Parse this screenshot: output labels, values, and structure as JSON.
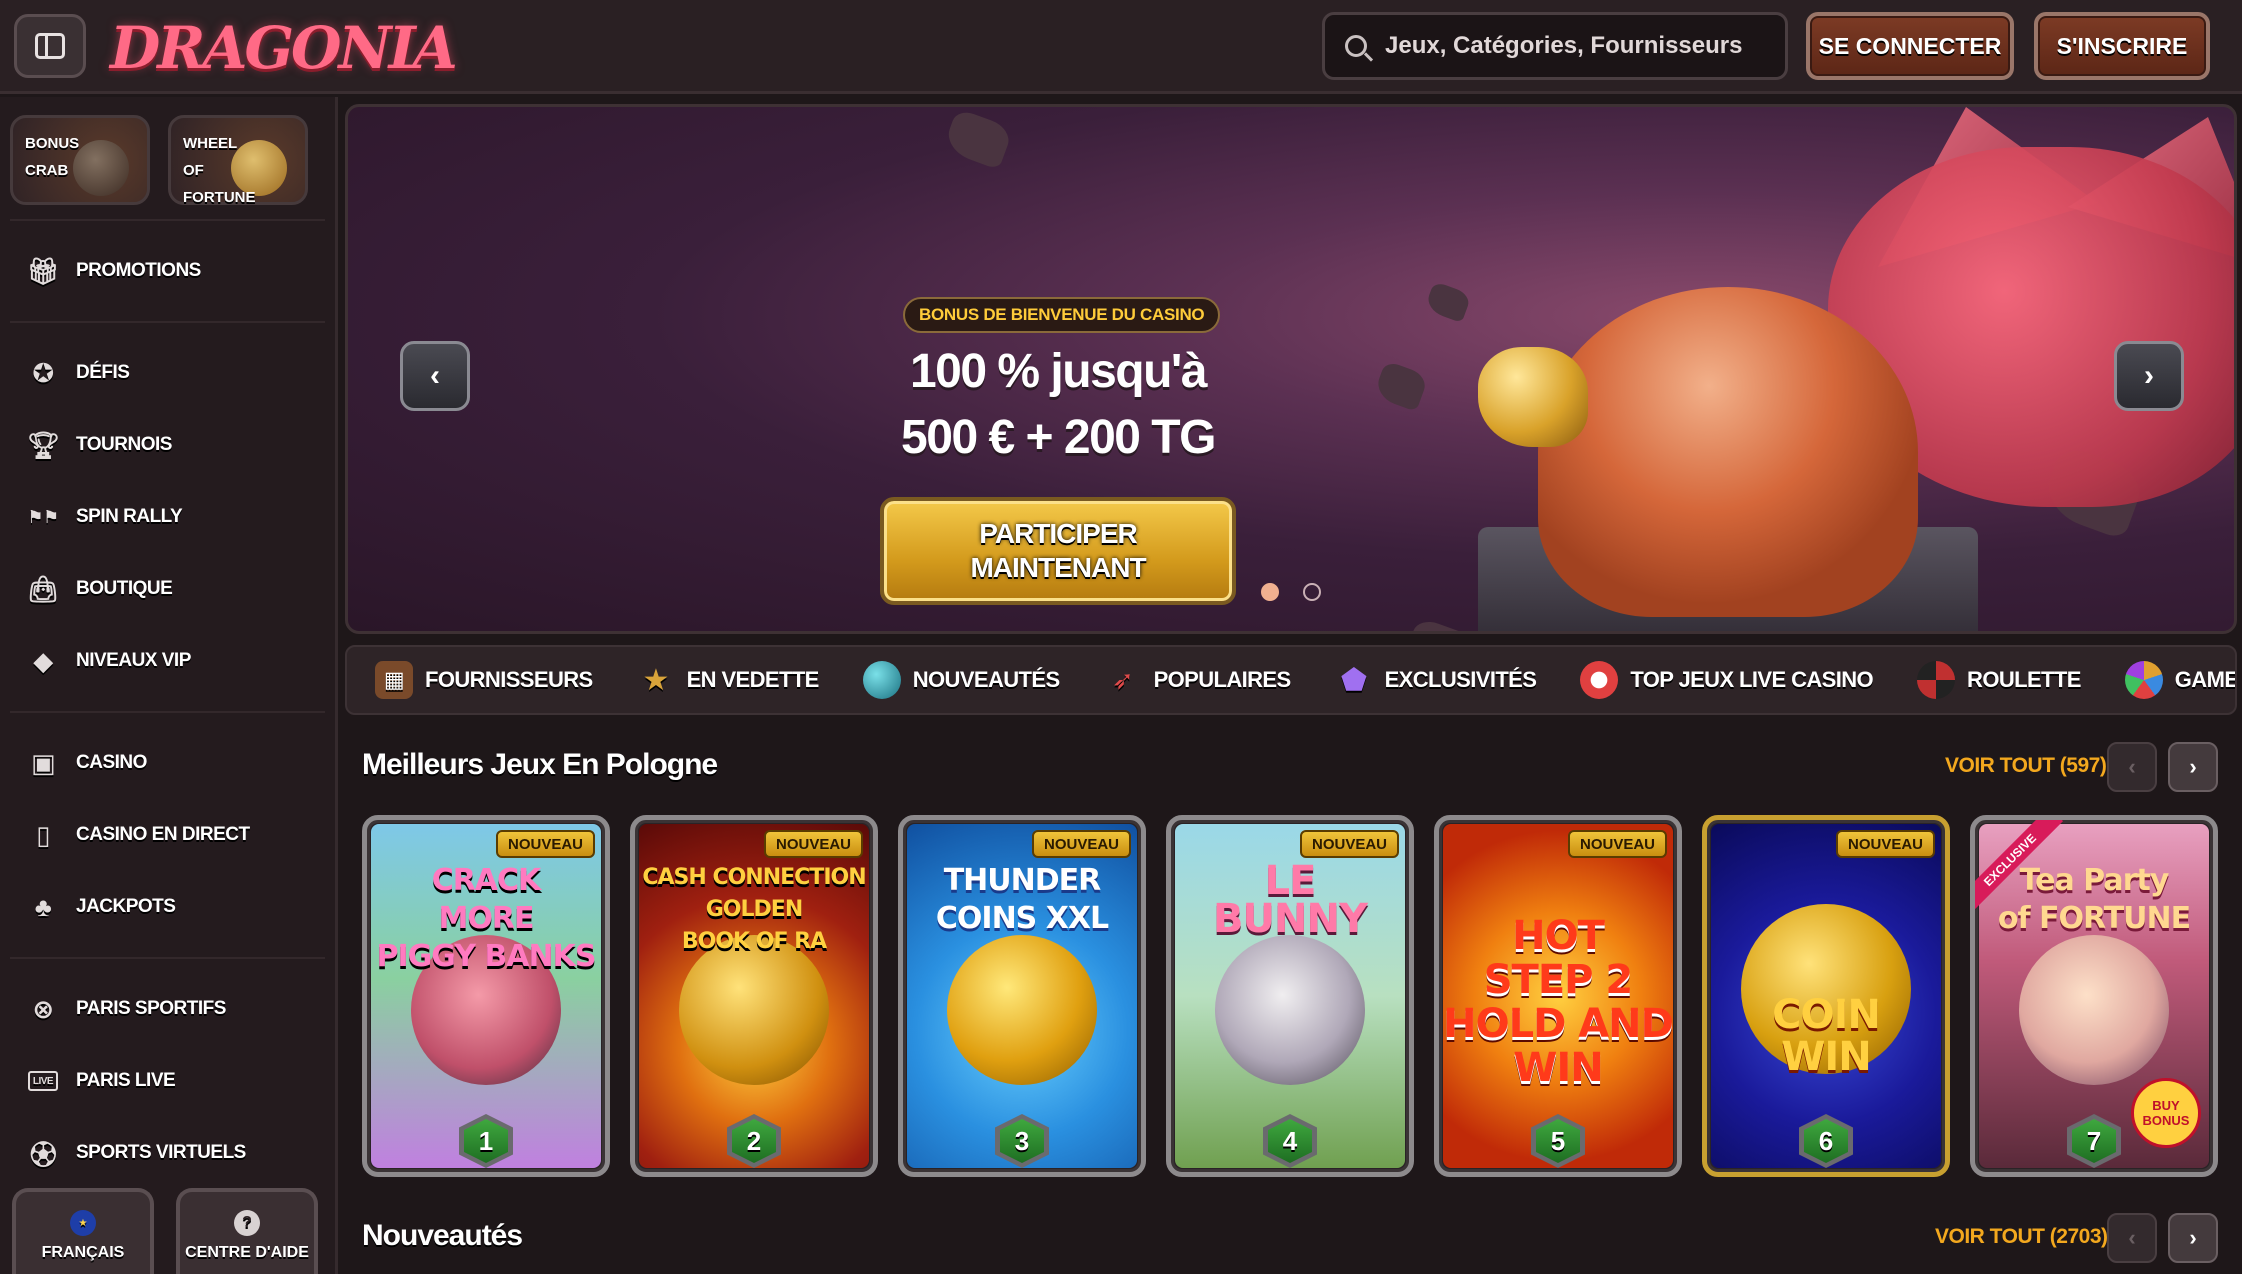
{
  "header": {
    "logo": "DRAGONIA",
    "search_placeholder": "Jeux, Catégories, Fournisseurs",
    "login": "SE CONNECTER",
    "signup": "S'INSCRIRE"
  },
  "sidebar": {
    "tiles": [
      {
        "label": "BONUS\nCRAB"
      },
      {
        "label": "WHEEL\nOF\nFORTUNE"
      }
    ],
    "items": [
      {
        "label": "PROMOTIONS",
        "icon": "gift-icon"
      },
      {
        "label": "DÉFIS",
        "icon": "medal-icon"
      },
      {
        "label": "TOURNOIS",
        "icon": "trophy-icon"
      },
      {
        "label": "SPIN RALLY",
        "icon": "rally-icon"
      },
      {
        "label": "BOUTIQUE",
        "icon": "shopping-bag-icon"
      },
      {
        "label": "NIVEAUX VIP",
        "icon": "diamond-icon"
      },
      {
        "label": "CASINO",
        "icon": "slot-machine-icon"
      },
      {
        "label": "CASINO EN DIRECT",
        "icon": "live-cards-icon"
      },
      {
        "label": "JACKPOTS",
        "icon": "clover-icon"
      },
      {
        "label": "PARIS SPORTIFS",
        "icon": "basketball-icon"
      },
      {
        "label": "PARIS LIVE",
        "icon": "live-icon"
      },
      {
        "label": "SPORTS VIRTUELS",
        "icon": "virtual-sports-icon"
      }
    ],
    "language": "FRANÇAIS",
    "help": "CENTRE D'AIDE"
  },
  "hero": {
    "badge": "BONUS DE BIENVENUE DU CASINO",
    "title_line1": "100 % jusqu'à",
    "title_line2": "500 € + 200 TG",
    "cta_line1": "PARTICIPER",
    "cta_line2": "MAINTENANT",
    "slides": 2,
    "active_slide": 1
  },
  "categories": [
    {
      "label": "FOURNISSEURS",
      "color": "#c98a3a"
    },
    {
      "label": "EN VEDETTE",
      "color": "#d8a33a"
    },
    {
      "label": "NOUVEAUTÉS",
      "color": "#2aa0a8"
    },
    {
      "label": "POPULAIRES",
      "color": "#d83a3a"
    },
    {
      "label": "EXCLUSIVITÉS",
      "color": "#8a4ad8"
    },
    {
      "label": "TOP JEUX LIVE CASINO",
      "color": "#e04040"
    },
    {
      "label": "ROULETTE",
      "color": "#6a8aa8"
    },
    {
      "label": "GAME SHOWS",
      "color": "#e0a030"
    }
  ],
  "section1": {
    "title": "Meilleurs Jeux En Pologne",
    "see_all": "VOIR TOUT (597)",
    "games": [
      {
        "title": "CRACK\nMORE\nPIGGY BANKS",
        "badge": "NOUVEAU",
        "rank": "1"
      },
      {
        "title": "CASH CONNECTION\nGOLDEN\nBOOK OF RA",
        "badge": "NOUVEAU",
        "rank": "2"
      },
      {
        "title": "THUNDER\nCOINS XXL",
        "badge": "NOUVEAU",
        "rank": "3"
      },
      {
        "title": "LE\nBUNNY",
        "badge": "NOUVEAU",
        "rank": "4"
      },
      {
        "title": "HOT\nSTEP 2\nHOLD AND WIN",
        "badge": "NOUVEAU",
        "rank": "5"
      },
      {
        "title": "COIN\nWIN",
        "badge": "NOUVEAU",
        "rank": "6"
      },
      {
        "title": "Tea Party\nof FORTUNE",
        "badge": "EXCLUSIVE",
        "rank": "7",
        "extra": "BUY BONUS"
      }
    ]
  },
  "section2": {
    "title": "Nouveautés",
    "see_all": "VOIR TOUT (2703)"
  }
}
